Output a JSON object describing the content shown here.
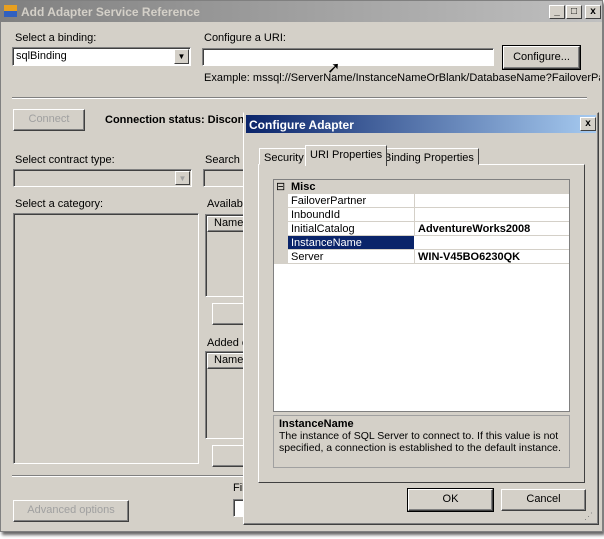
{
  "main": {
    "title": "Add Adapter Service Reference",
    "min": "_",
    "max": "□",
    "close": "x",
    "binding_label": "Select a binding:",
    "binding_value": "sqlBinding",
    "uri_label": "Configure a URI:",
    "uri_value": "",
    "configure_button": "Configure...",
    "example": "Example: mssql://ServerName/InstanceNameOrBlank/DatabaseName?FailoverPartner=pa",
    "connect_button": "Connect",
    "status": "Connection status: Disconn",
    "contract_label": "Select contract type:",
    "search_label": "Search i",
    "category_label": "Select a category:",
    "available_label": "Available",
    "available_col": "Name",
    "added_label": "Added c",
    "added_col": "Name",
    "file_label": "Fil",
    "advanced_button": "Advanced options"
  },
  "dialog": {
    "title": "Configure Adapter",
    "close": "x",
    "tabs": [
      {
        "label": "Security"
      },
      {
        "label": "URI Properties"
      },
      {
        "label": "Binding Properties"
      }
    ],
    "category": "Misc",
    "collapse": "⊟",
    "properties": [
      {
        "name": "FailoverPartner",
        "value": ""
      },
      {
        "name": "InboundId",
        "value": ""
      },
      {
        "name": "InitialCatalog",
        "value": "AdventureWorks2008"
      },
      {
        "name": "InstanceName",
        "value": ""
      },
      {
        "name": "Server",
        "value": "WIN-V45BO6230QK"
      }
    ],
    "desc_title": "InstanceName",
    "desc_text": "The instance of SQL Server to connect to. If this value is not specified, a connection is established to the default instance.",
    "ok": "OK",
    "cancel": "Cancel"
  }
}
